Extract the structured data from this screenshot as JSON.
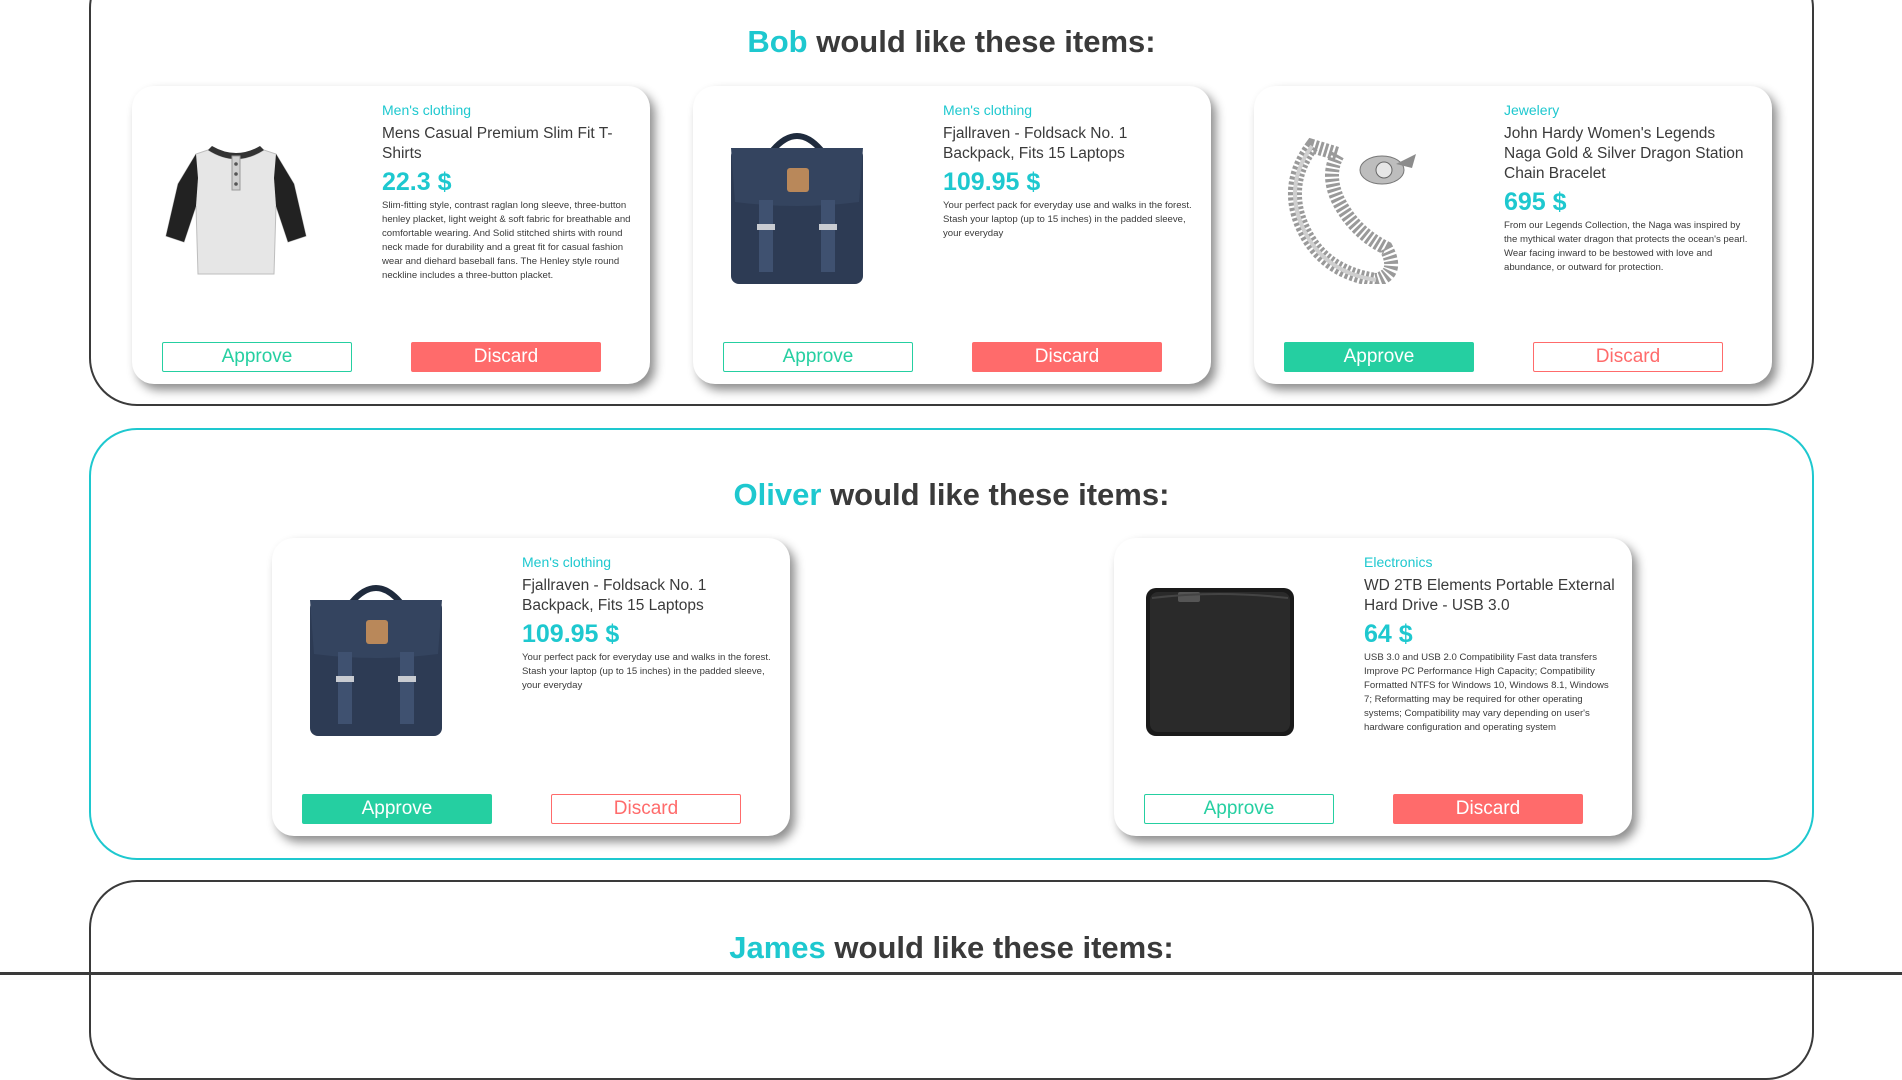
{
  "suffix": "would like these items:",
  "groups": [
    {
      "user": "Bob",
      "items": [
        {
          "category": "Men's clothing",
          "name": "Mens Casual Premium Slim Fit T-Shirts",
          "price": "22.3 $",
          "description": "Slim-fitting style, contrast raglan long sleeve, three-button henley placket, light weight & soft fabric for breathable and comfortable wearing. And Solid stitched shirts with round neck made for durability and a great fit for casual fashion wear and diehard baseball fans. The Henley style round neckline includes a three-button placket.",
          "image": "tshirt-image",
          "approve_label": "Approve",
          "discard_label": "Discard",
          "state": "discarded"
        },
        {
          "category": "Men's clothing",
          "name": "Fjallraven - Foldsack No. 1 Backpack, Fits 15 Laptops",
          "price": "109.95 $",
          "description": "Your perfect pack for everyday use and walks in the forest. Stash your laptop (up to 15 inches) in the padded sleeve, your everyday",
          "image": "backpack-image",
          "approve_label": "Approve",
          "discard_label": "Discard",
          "state": "discarded"
        },
        {
          "category": "Jewelery",
          "name": "John Hardy Women's Legends Naga Gold & Silver Dragon Station Chain Bracelet",
          "price": "695 $",
          "description": "From our Legends Collection, the Naga was inspired by the mythical water dragon that protects the ocean's pearl. Wear facing inward to be bestowed with love and abundance, or outward for protection.",
          "image": "bracelet-image",
          "approve_label": "Approve",
          "discard_label": "Discard",
          "state": "approved"
        }
      ]
    },
    {
      "user": "Oliver",
      "items": [
        {
          "category": "Men's clothing",
          "name": "Fjallraven - Foldsack No. 1 Backpack, Fits 15 Laptops",
          "price": "109.95 $",
          "description": "Your perfect pack for everyday use and walks in the forest. Stash your laptop (up to 15 inches) in the padded sleeve, your everyday",
          "image": "backpack-image",
          "approve_label": "Approve",
          "discard_label": "Discard",
          "state": "approved"
        },
        {
          "category": "Electronics",
          "name": "WD 2TB Elements Portable External Hard Drive - USB 3.0",
          "price": "64 $",
          "description": "USB 3.0 and USB 2.0 Compatibility Fast data transfers Improve PC Performance High Capacity; Compatibility Formatted NTFS for Windows 10, Windows 8.1, Windows 7; Reformatting may be required for other operating systems; Compatibility may vary depending on user's hardware configuration and operating system",
          "image": "hard-drive-image",
          "approve_label": "Approve",
          "discard_label": "Discard",
          "state": "discarded"
        }
      ]
    },
    {
      "user": "James",
      "items": []
    }
  ],
  "colors": {
    "accent": "#1ec8cf",
    "approve": "#25cfa1",
    "discard": "#ff6b6b",
    "text": "#3a3a3a"
  }
}
